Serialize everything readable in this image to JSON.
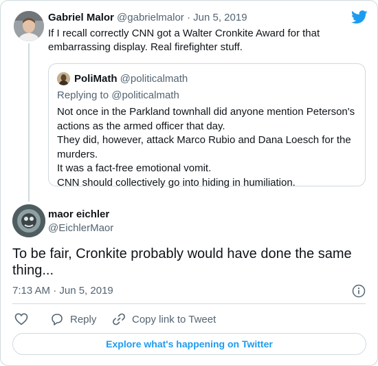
{
  "parent_tweet": {
    "name": "Gabriel Malor",
    "handle": "@gabrielmalor",
    "separator": " · ",
    "date": "Jun 5, 2019",
    "text_line1": "If I recall correctly CNN got a Walter Cronkite Award for that",
    "text_line2": "embarrassing display. Real firefighter stuff."
  },
  "quoted_tweet": {
    "name": "PoliMath",
    "handle": "@politicalmath",
    "replying_to": "Replying to @politicalmath",
    "lines": [
      "Not once in the Parkland townhall did anyone mention Peterson's",
      "actions as the armed officer that day.",
      "They did, however, attack Marco Rubio and Dana Loesch for the",
      "murders.",
      "It was a fact-free emotional vomit.",
      "CNN should collectively go into hiding in humiliation."
    ]
  },
  "main_tweet": {
    "name": "maor eichler",
    "handle": "@EichlerMaor",
    "text_line1": "To be fair, Cronkite probably would have done the same",
    "text_line2": "thing...",
    "timestamp": "7:13 AM · Jun 5, 2019"
  },
  "actions": {
    "reply_label": "Reply",
    "copy_link_label": "Copy link to Tweet",
    "explore_label": "Explore what's happening on Twitter"
  },
  "icons": {
    "brand": "twitter-bird-icon",
    "like": "heart-icon",
    "reply": "speech-bubble-icon",
    "copy": "link-icon",
    "info": "info-icon"
  },
  "colors": {
    "accent": "#1d9bf0",
    "secondary_text": "#536471",
    "border": "#cfd9de"
  }
}
